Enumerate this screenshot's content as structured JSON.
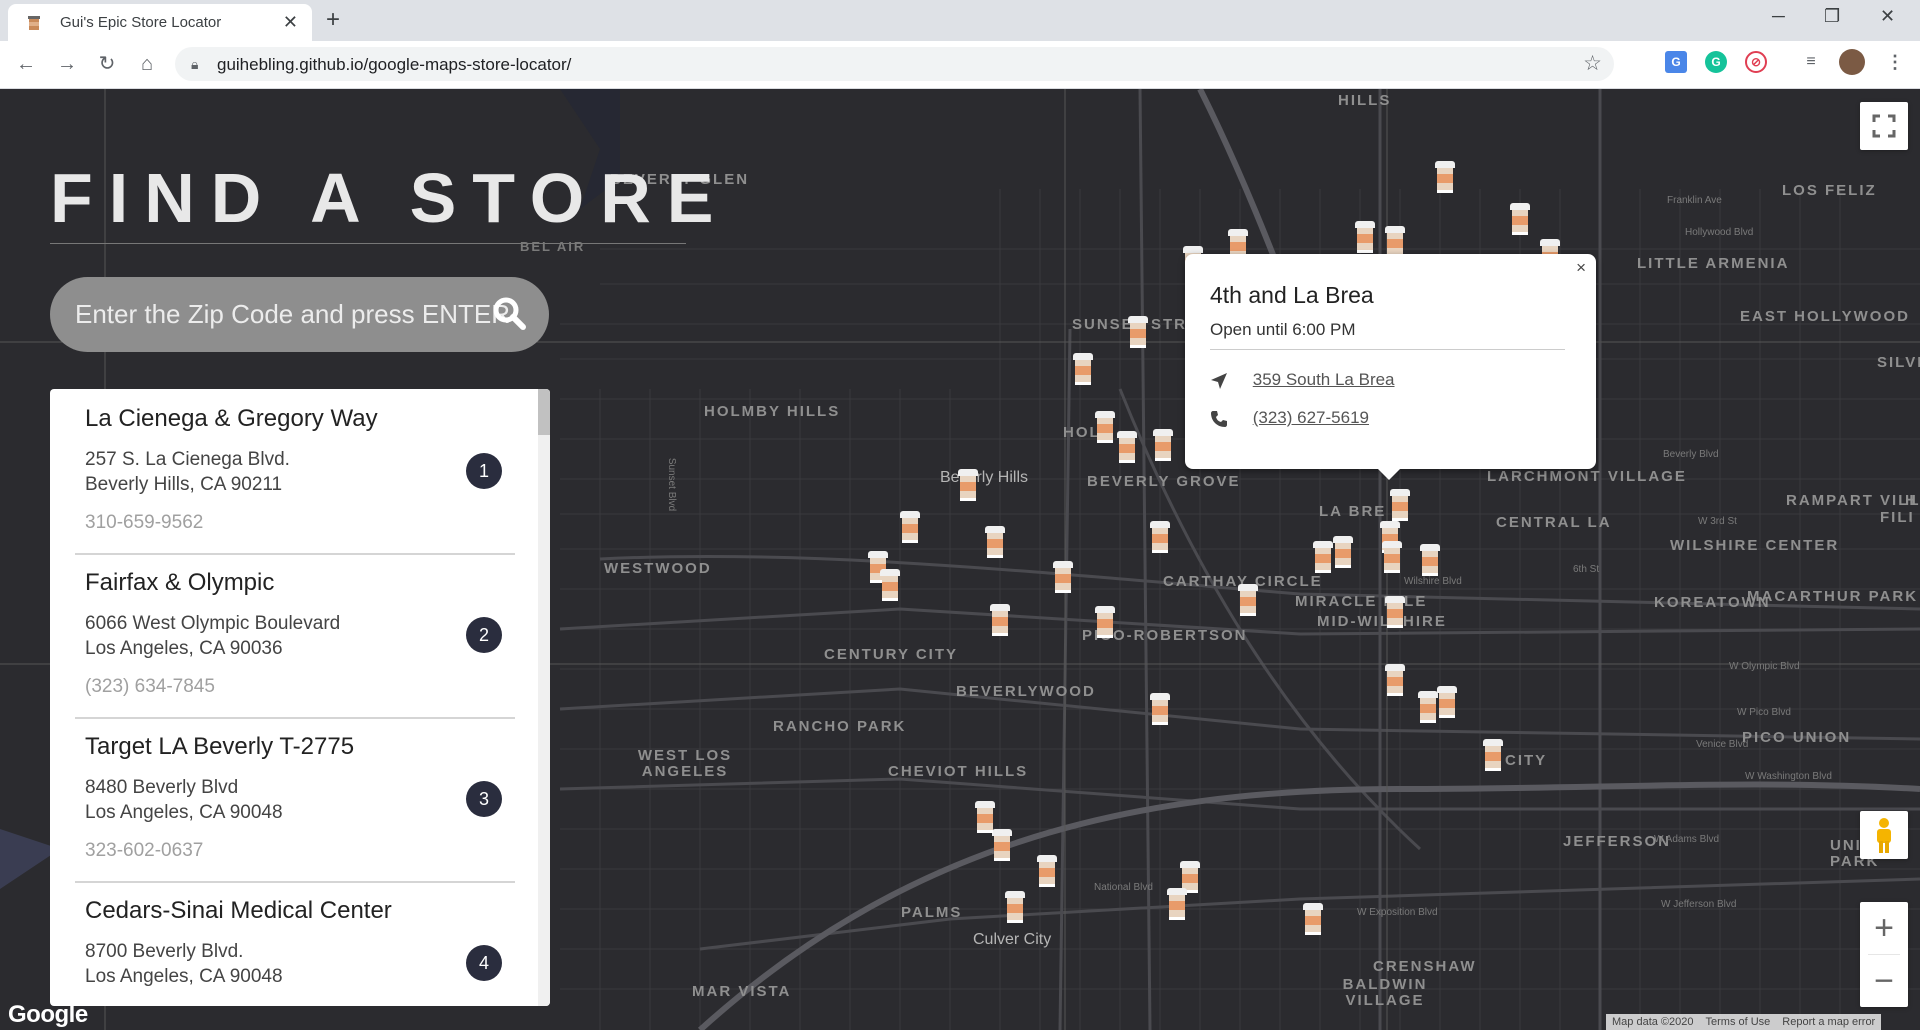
{
  "browser": {
    "tab_title": "Gui's Epic Store Locator",
    "tab_close": "✕",
    "new_tab": "+",
    "url": "guihebling.github.io/google-maps-store-locator/",
    "win_min": "─",
    "win_max": "❐",
    "win_close": "✕"
  },
  "page": {
    "heading": "FIND A STORE",
    "search_placeholder": "Enter the Zip Code and press ENTER"
  },
  "stores": [
    {
      "name": "La Cienega & Gregory Way",
      "address1": "257 S. La Cienega Blvd.",
      "address2": "Beverly Hills, CA 90211",
      "phone": "310-659-9562",
      "number": "1"
    },
    {
      "name": "Fairfax & Olympic",
      "address1": "6066 West Olympic Boulevard",
      "address2": "Los Angeles, CA 90036",
      "phone": "(323) 634-7845",
      "number": "2"
    },
    {
      "name": "Target LA Beverly T-2775",
      "address1": "8480 Beverly Blvd",
      "address2": "Los Angeles, CA 90048",
      "phone": "323-602-0637",
      "number": "3"
    },
    {
      "name": "Cedars-Sinai Medical Center",
      "address1": "8700 Beverly Blvd.",
      "address2": "Los Angeles, CA 90048",
      "phone": "",
      "number": "4"
    }
  ],
  "info_window": {
    "name": "4th and La Brea",
    "hours": "Open until 6:00 PM",
    "address": "359 South La Brea",
    "phone": "(323) 627-5619",
    "close": "×"
  },
  "map": {
    "places": [
      "HILLS",
      "BEVERLY GLEN",
      "BEL AIR",
      "LOS FELIZ",
      "LITTLE ARMENIA",
      "EAST HOLLYWOOD",
      "SILVE",
      "SUNSET STR",
      "HOLMBY HILLS",
      "BEVERLY GROVE",
      "LARCHMONT VILLAGE",
      "CENTRAL LA",
      "RAMPART VILLAGE",
      "WILSHIRE CENTER",
      "KOREATOWN",
      "MACARTHUR PARK",
      "WESTWOOD",
      "CARTHAY CIRCLE",
      "MIRACLE MILE",
      "MID-WILSHIRE",
      "CENTURY CITY",
      "PICO-ROBERTSON",
      "BEVERLYWOOD",
      "RANCHO PARK",
      "WEST LOS ANGELES",
      "CHEVIOT HILLS",
      "PICO UNION",
      "JEFFERSON",
      "UNIV PARK",
      "PALMS",
      "CRENSHAW",
      "BALDWIN VILLAGE",
      "MAR VISTA",
      "LA BRE",
      "HOL",
      "FILI",
      "H",
      "CITY"
    ],
    "cities": [
      "Beverly Hills",
      "Culver City"
    ],
    "streets": [
      "Franklin Ave",
      "Hollywood Blvd",
      "Sunset Blvd",
      "Wilshire Blvd",
      "W Olympic Blvd",
      "W Pico Blvd",
      "Venice Blvd",
      "W Washington Blvd",
      "W Adams Blvd",
      "W Jefferson Blvd",
      "National Blvd",
      "W 3rd St",
      "6th St",
      "Beverly Blvd",
      "W Exposition Blvd"
    ],
    "google_logo": "Google",
    "attribution": [
      "Map data ©2020",
      "Terms of Use",
      "Report a map error"
    ]
  },
  "colors": {
    "accent_dark": "#2a2d3e",
    "map_bg": "#2b2b2f",
    "search_bg": "#8e8e8e",
    "cup_band": "#e89b6a"
  }
}
